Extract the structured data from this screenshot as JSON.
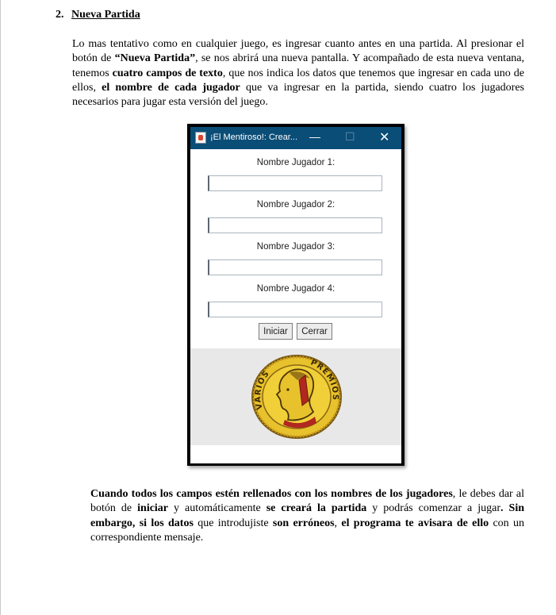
{
  "section": {
    "number": "2.",
    "title": "Nueva Partida"
  },
  "paragraph1": {
    "t1": "Lo mas tentativo como en cualquier juego, es ingresar cuanto antes en una partida. Al presionar el botón de ",
    "b1": "“Nueva Partida”",
    "t2": ", se nos abrirá una nueva pantalla. Y acompañado de esta nueva ventana, tenemos ",
    "b2": "cuatro campos de texto",
    "t3": ", que nos indica los datos que tenemos que ingresar en cada uno de ellos, ",
    "b3": "el nombre de cada jugador",
    "t4": " que va ingresar en la partida, siendo cuatro los jugadores necesarios para jugar esta versión del juego."
  },
  "window": {
    "title": "¡El Mentiroso!: Crear...",
    "minimize_glyph": "—",
    "maximize_glyph": "☐",
    "close_glyph": "✕",
    "fields": [
      {
        "label": "Nombre Jugador 1:",
        "value": ""
      },
      {
        "label": "Nombre Jugador 2:",
        "value": ""
      },
      {
        "label": "Nombre Jugador 3:",
        "value": ""
      },
      {
        "label": "Nombre Jugador 4:",
        "value": ""
      }
    ],
    "start_button": "Iniciar",
    "close_button": "Cerrar",
    "coin": {
      "left_text": "VARIOS",
      "right_text": "PREMIOS"
    }
  },
  "paragraph2": {
    "b1": "Cuando todos los campos estén rellenados con los nombres de los jugadores",
    "t1": ", le debes dar al botón de ",
    "b2": "iniciar",
    "t2": " y automáticamente ",
    "b3": "se creará la partida",
    "t3": " y podrás comenzar a jugar",
    "b4": ". Sin embargo, si los datos",
    "t4": " que introdujiste ",
    "b5": "son erróneos",
    "t5": ", ",
    "b6": "el programa te avisara de ello",
    "t6": " con un correspondiente mensaje."
  },
  "colors": {
    "titlebar": "#0a4d77",
    "coin_gold": "#e6c12a",
    "coin_red": "#b0281f"
  }
}
